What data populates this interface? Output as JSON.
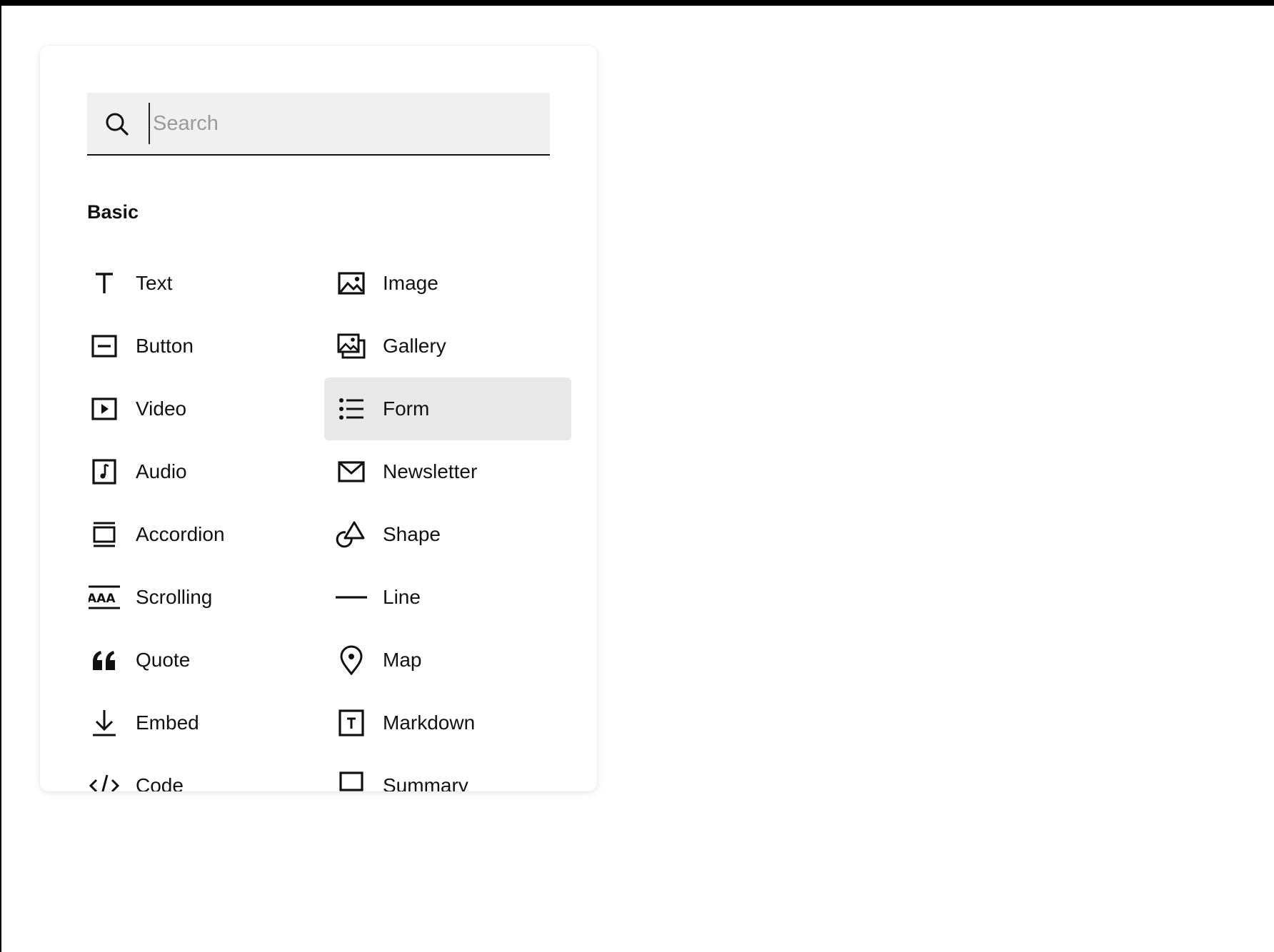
{
  "search": {
    "placeholder": "Search",
    "value": ""
  },
  "section": {
    "title": "Basic"
  },
  "blocks": [
    {
      "label": "Text",
      "icon": "text-icon"
    },
    {
      "label": "Image",
      "icon": "image-icon"
    },
    {
      "label": "Button",
      "icon": "button-icon"
    },
    {
      "label": "Gallery",
      "icon": "gallery-icon"
    },
    {
      "label": "Video",
      "icon": "video-icon"
    },
    {
      "label": "Form",
      "icon": "form-icon",
      "selected": true
    },
    {
      "label": "Audio",
      "icon": "audio-icon"
    },
    {
      "label": "Newsletter",
      "icon": "newsletter-icon"
    },
    {
      "label": "Accordion",
      "icon": "accordion-icon"
    },
    {
      "label": "Shape",
      "icon": "shape-icon"
    },
    {
      "label": "Scrolling",
      "icon": "scrolling-icon"
    },
    {
      "label": "Line",
      "icon": "line-icon"
    },
    {
      "label": "Quote",
      "icon": "quote-icon"
    },
    {
      "label": "Map",
      "icon": "map-pin-icon"
    },
    {
      "label": "Embed",
      "icon": "embed-icon"
    },
    {
      "label": "Markdown",
      "icon": "markdown-icon"
    },
    {
      "label": "Code",
      "icon": "code-icon"
    },
    {
      "label": "Summary",
      "icon": "summary-icon"
    }
  ],
  "colors": {
    "selected_bg": "#e8e8e8",
    "search_bg": "#f0f0f0"
  }
}
